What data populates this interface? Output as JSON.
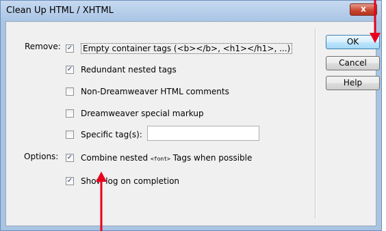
{
  "window": {
    "title": "Clean Up HTML / XHTML",
    "close_glyph": "x"
  },
  "remove": {
    "label": "Remove:",
    "items": [
      {
        "text": "Empty container tags (<b></b>, <h1></h1>, ...)",
        "checked": true
      },
      {
        "text": "Redundant nested tags",
        "checked": true
      },
      {
        "text": "Non-Dreamweaver HTML comments",
        "checked": false
      },
      {
        "text": "Dreamweaver special markup",
        "checked": false
      },
      {
        "text": "Specific tag(s):",
        "checked": false,
        "input_value": ""
      }
    ]
  },
  "options": {
    "label": "Options:",
    "combine": {
      "before": "Combine nested ",
      "code": "<font>",
      "after": " Tags when possible",
      "checked": true
    },
    "show_log": {
      "text": "Show log on completion",
      "checked": true
    }
  },
  "buttons": {
    "ok": "OK",
    "cancel": "Cancel",
    "help": "Help"
  },
  "check_glyph": "✓",
  "colors": {
    "accent_arrow": "#e8001c",
    "title_bar": "#b9d1ea",
    "dialog_bg": "#f0f0f0"
  }
}
